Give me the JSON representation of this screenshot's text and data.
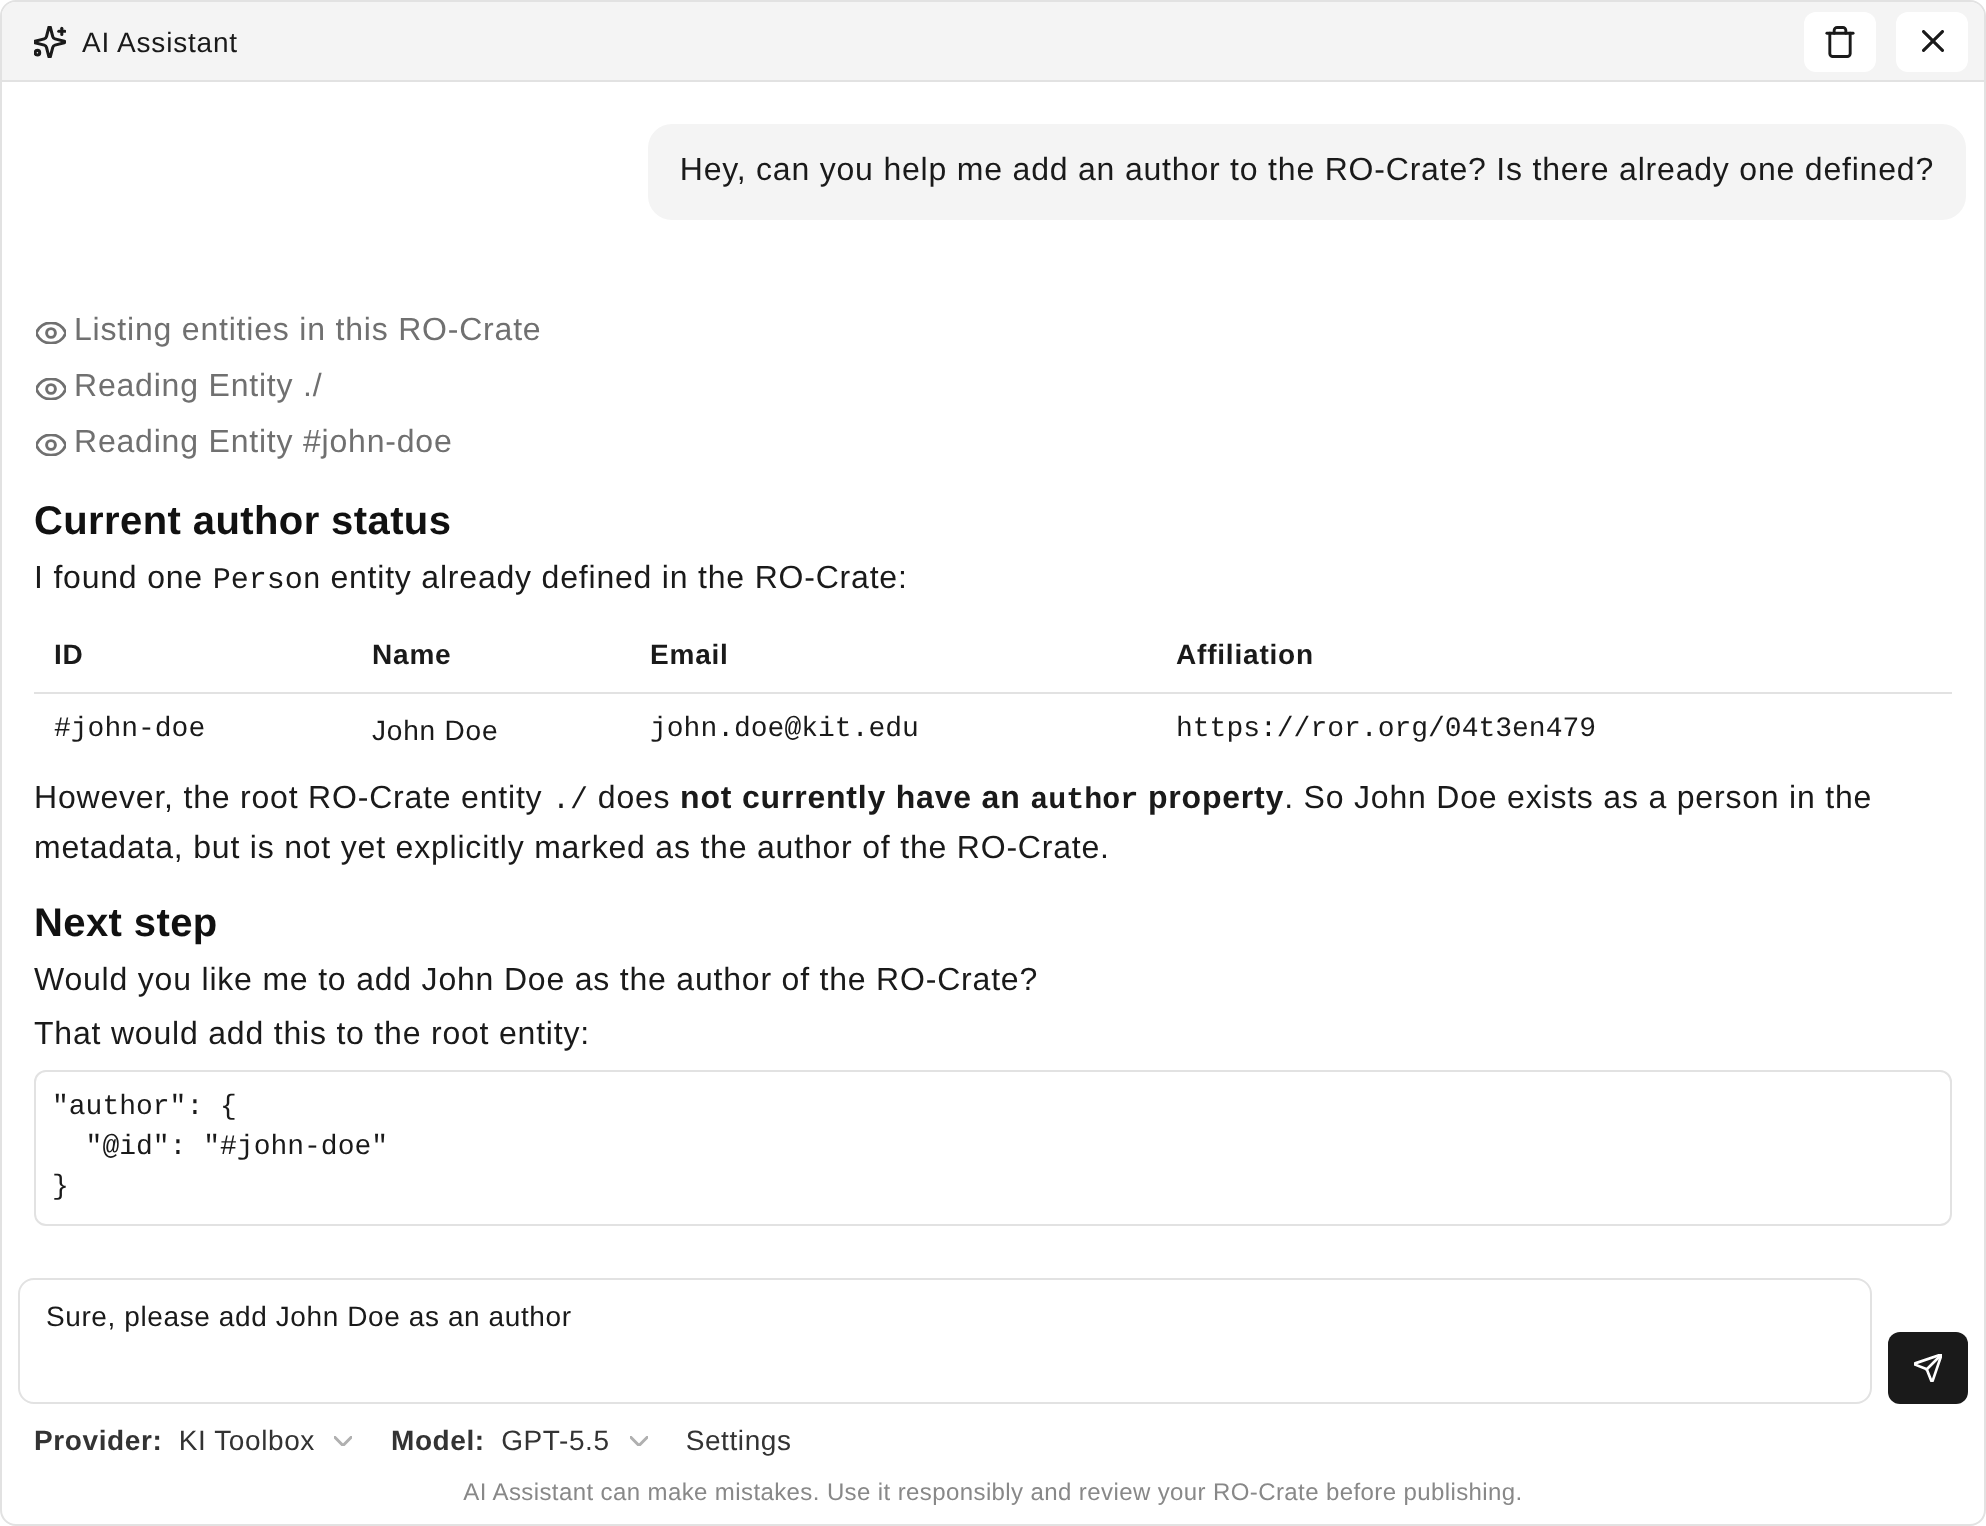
{
  "window": {
    "title": "AI Assistant"
  },
  "messages": [
    {
      "kind": "user",
      "text": "Hey, can you help me add an author to the RO-Crate? Is there already one defined?"
    },
    {
      "kind": "assistant",
      "tool_calls": [
        "Listing entities in this RO-Crate",
        "Reading Entity ./",
        "Reading Entity #john-doe"
      ],
      "blocks": [
        {
          "kind": "heading",
          "text": "Current author status"
        },
        {
          "kind": "paragraph",
          "segments": [
            {
              "kind": "plain",
              "text": "I found one "
            },
            {
              "kind": "code",
              "text": "Person"
            },
            {
              "kind": "plain",
              "text": " entity already defined in the RO-Crate:"
            }
          ]
        },
        {
          "kind": "table",
          "columns": [
            {
              "label": "ID",
              "kind": "code"
            },
            {
              "label": "Name",
              "kind": "plain"
            },
            {
              "label": "Email",
              "kind": "code"
            },
            {
              "label": "Affiliation",
              "kind": "code"
            }
          ],
          "rows": [
            [
              "#john-doe",
              "John Doe",
              "john.doe@kit.edu",
              "https://ror.org/04t3en479"
            ]
          ]
        },
        {
          "kind": "paragraph",
          "segments": [
            {
              "kind": "plain",
              "text": "However, the root RO-Crate entity "
            },
            {
              "kind": "code",
              "text": "./"
            },
            {
              "kind": "plain",
              "text": " does "
            },
            {
              "kind": "bold",
              "text": "not currently have an "
            },
            {
              "kind": "bold-code",
              "text": "author"
            },
            {
              "kind": "bold",
              "text": " property"
            },
            {
              "kind": "plain",
              "text": ". So John Doe exists as a person in the metadata, but is not yet explicitly marked as the author of the RO-Crate."
            }
          ]
        },
        {
          "kind": "heading",
          "text": "Next step"
        },
        {
          "kind": "paragraph",
          "segments": [
            {
              "kind": "plain",
              "text": "Would you like me to add John Doe as the author of the RO-Crate?"
            }
          ]
        },
        {
          "kind": "paragraph",
          "segments": [
            {
              "kind": "plain",
              "text": "That would add this to the root entity:"
            }
          ]
        },
        {
          "kind": "code",
          "text": "\"author\": {\n  \"@id\": \"#john-doe\"\n}"
        }
      ]
    }
  ],
  "composer": {
    "value": "Sure, please add John Doe as an author"
  },
  "footer": {
    "provider": {
      "label": "Provider:",
      "value": "KI Toolbox"
    },
    "model": {
      "label": "Model:",
      "value": "GPT-5.5"
    },
    "settings": "Settings",
    "disclaimer": "AI Assistant can make mistakes. Use it responsibly and review your RO-Crate before publishing."
  }
}
